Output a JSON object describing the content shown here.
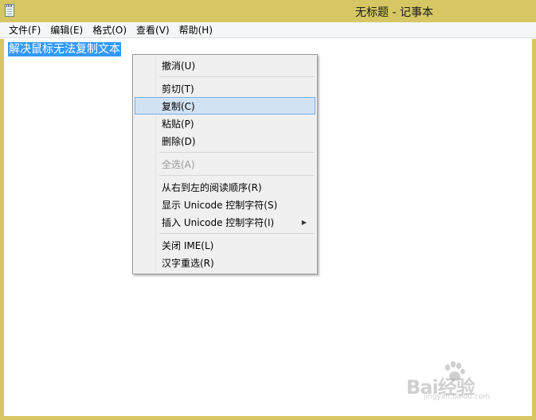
{
  "window": {
    "title": "无标题 - 记事本",
    "icon": "notepad-icon"
  },
  "menubar": {
    "items": [
      "文件(F)",
      "编辑(E)",
      "格式(O)",
      "查看(V)",
      "帮助(H)"
    ]
  },
  "editor": {
    "selected_text": "解决鼠标无法复制文本"
  },
  "context_menu": {
    "items": [
      {
        "label": "撤消(U)",
        "state": "normal"
      },
      {
        "label": "剪切(T)",
        "state": "normal"
      },
      {
        "label": "复制(C)",
        "state": "highlighted"
      },
      {
        "label": "粘贴(P)",
        "state": "normal"
      },
      {
        "label": "删除(D)",
        "state": "normal"
      },
      {
        "label": "全选(A)",
        "state": "disabled"
      },
      {
        "label": "从右到左的阅读顺序(R)",
        "state": "normal"
      },
      {
        "label": "显示 Unicode 控制字符(S)",
        "state": "normal"
      },
      {
        "label": "插入 Unicode 控制字符(I)",
        "state": "submenu"
      },
      {
        "label": "关闭 IME(L)",
        "state": "normal"
      },
      {
        "label": "汉字重选(R)",
        "state": "normal"
      }
    ]
  },
  "watermark": {
    "text": "Bai经验",
    "sub": "jingyan.baidu.com"
  },
  "colors": {
    "frame": "#d6c764",
    "selection": "#3399ff",
    "menu_highlight": "#d1e2f2",
    "menu_highlight_border": "#78aee5"
  }
}
